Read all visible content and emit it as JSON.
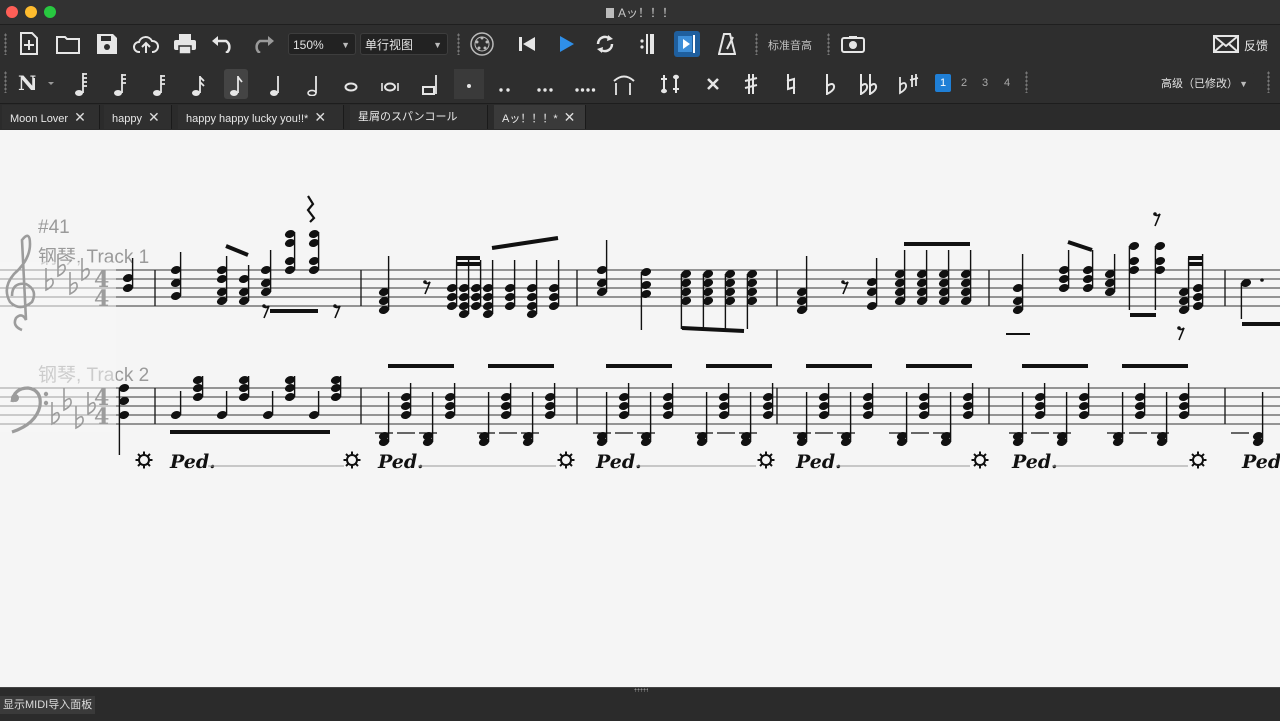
{
  "window": {
    "title": "Aッ！！！"
  },
  "toolbar": {
    "zoom": "150%",
    "view_mode": "单行视图",
    "tuning_label": "标准音高",
    "feedback_label": "反馈"
  },
  "note_bar": {
    "voices": [
      "1",
      "2",
      "3",
      "4"
    ],
    "active_voice": "1",
    "level": "高级（已修改）"
  },
  "tabs": [
    {
      "label": "Moon Lover"
    },
    {
      "label": "happy"
    },
    {
      "label": "happy happy lucky you!!*"
    },
    {
      "label": "星屑のスパンコール*"
    },
    {
      "label": "Aッ！！！*"
    }
  ],
  "score": {
    "measure_number": "#41",
    "staves": [
      {
        "name": "钢琴, Track 1",
        "clef": "treble",
        "time_signature": "4/4",
        "key": "4 flats"
      },
      {
        "name": "钢琴, Track 2",
        "clef": "bass",
        "time_signature": "4/4",
        "key": "4 flats"
      }
    ],
    "pedal_mark": "Ped."
  },
  "statusbar": {
    "midi_panel_label": "显示MIDI导入面板"
  }
}
